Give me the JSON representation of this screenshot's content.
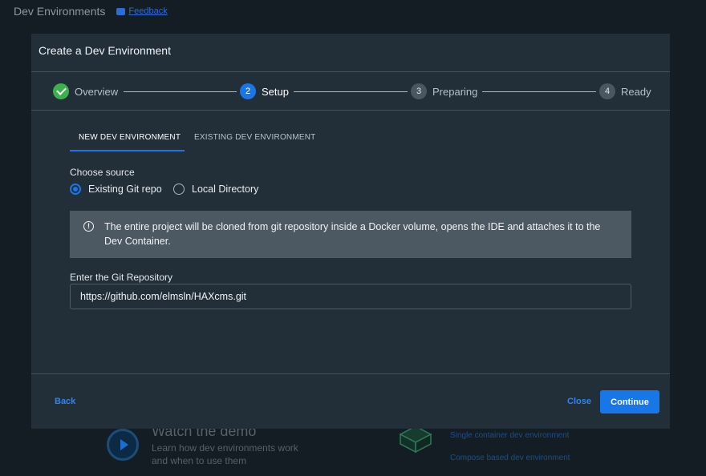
{
  "background": {
    "title": "Dev Environments",
    "feedback": "Feedback",
    "demo_title": "Watch the demo",
    "demo_sub1": "Learn how dev environments work",
    "demo_sub2": "and when to use them",
    "links": [
      "Single container dev environment",
      "Compose based dev environment"
    ]
  },
  "modal": {
    "title": "Create a Dev Environment",
    "steps": [
      {
        "num": "",
        "label": "Overview",
        "state": "done"
      },
      {
        "num": "2",
        "label": "Setup",
        "state": "active"
      },
      {
        "num": "3",
        "label": "Preparing",
        "state": "pending"
      },
      {
        "num": "4",
        "label": "Ready",
        "state": "pending"
      }
    ],
    "tabs": [
      "NEW DEV ENVIRONMENT",
      "EXISTING DEV ENVIRONMENT"
    ],
    "choose_source": "Choose source",
    "sources": [
      "Existing Git repo",
      "Local Directory"
    ],
    "selected_source": "Existing Git repo",
    "info_text": "The entire project will be cloned from git repository inside a Docker volume, opens the IDE and attaches it to the Dev Container.",
    "repo_label": "Enter the Git Repository",
    "repo_value": "https://github.com/elmsln/HAXcms.git",
    "back": "Back",
    "close": "Close",
    "continue": "Continue"
  },
  "colors": {
    "accent": "#1976e8",
    "success": "#3db04d",
    "modal_bg": "#222f38"
  }
}
